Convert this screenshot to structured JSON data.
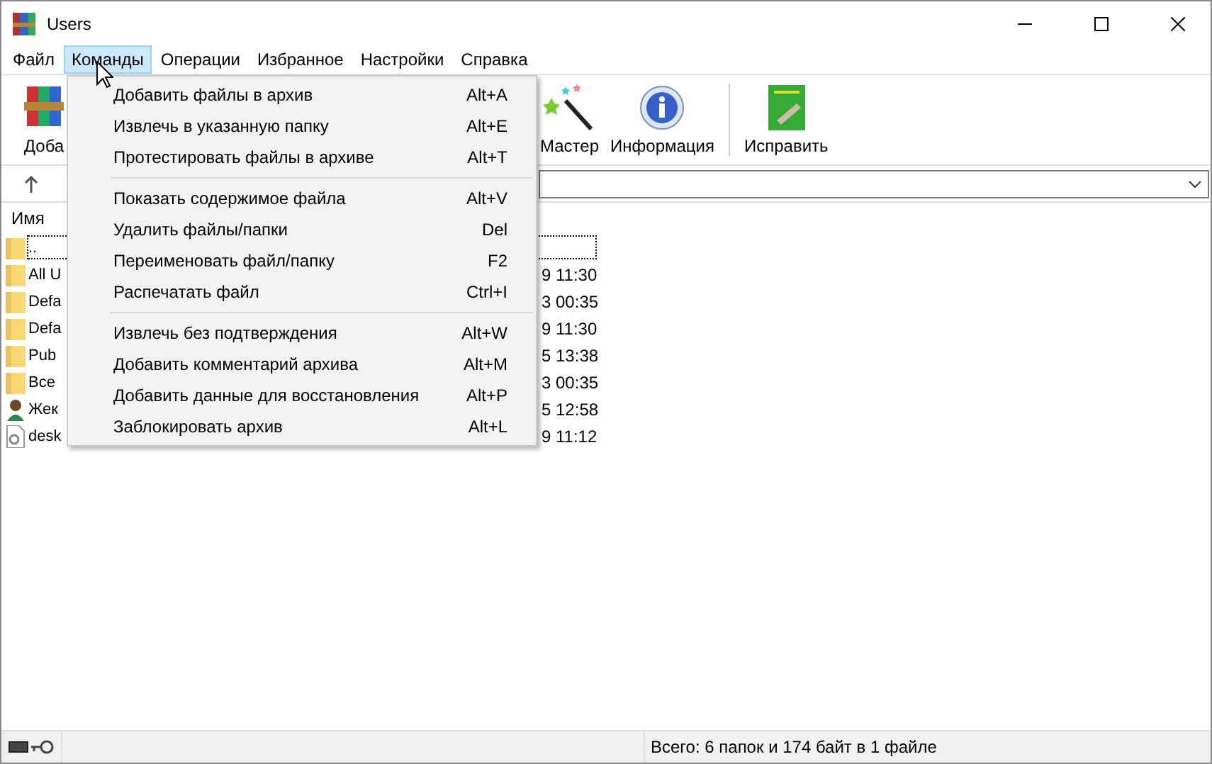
{
  "window": {
    "title": "Users"
  },
  "menubar": [
    {
      "label": "Файл",
      "selected": false
    },
    {
      "label": "Команды",
      "selected": true
    },
    {
      "label": "Операции",
      "selected": false
    },
    {
      "label": "Избранное",
      "selected": false
    },
    {
      "label": "Настройки",
      "selected": false
    },
    {
      "label": "Справка",
      "selected": false
    }
  ],
  "toolbar": [
    {
      "label": "Доба",
      "kind": "archive",
      "separator_before": false
    },
    {
      "label": "Мастер",
      "kind": "wizard",
      "separator_before": false
    },
    {
      "label": "Информация",
      "kind": "info",
      "separator_before": false
    },
    {
      "label": "Исправить",
      "kind": "repair",
      "separator_before": true
    }
  ],
  "file_list": {
    "columns": [
      "Имя"
    ],
    "rows": [
      {
        "name": "..",
        "kind": "folder",
        "focused": true
      },
      {
        "name": "All U",
        "kind": "folder",
        "focused": false,
        "modified": "9 11:30"
      },
      {
        "name": "Defa",
        "kind": "folder",
        "focused": false,
        "modified": "3 00:35"
      },
      {
        "name": "Defa",
        "kind": "folder",
        "focused": false,
        "modified": "9 11:30"
      },
      {
        "name": "Pub",
        "kind": "folder",
        "focused": false,
        "modified": "5 13:38"
      },
      {
        "name": "Все",
        "kind": "folder",
        "focused": false,
        "modified": "3 00:35"
      },
      {
        "name": "Жек",
        "kind": "user",
        "focused": false,
        "modified": "5 12:58"
      },
      {
        "name": "desk",
        "kind": "file",
        "focused": false,
        "modified": "9 11:12"
      }
    ]
  },
  "commands_menu": {
    "groups": [
      [
        {
          "label": "Добавить файлы в архив",
          "shortcut": "Alt+A"
        },
        {
          "label": "Извлечь в указанную папку",
          "shortcut": "Alt+E"
        },
        {
          "label": "Протестировать файлы в архиве",
          "shortcut": "Alt+T"
        }
      ],
      [
        {
          "label": "Показать содержимое файла",
          "shortcut": "Alt+V"
        },
        {
          "label": "Удалить файлы/папки",
          "shortcut": "Del"
        },
        {
          "label": "Переименовать файл/папку",
          "shortcut": "F2"
        },
        {
          "label": "Распечатать файл",
          "shortcut": "Ctrl+I"
        }
      ],
      [
        {
          "label": "Извлечь без подтверждения",
          "shortcut": "Alt+W"
        },
        {
          "label": "Добавить комментарий архива",
          "shortcut": "Alt+M"
        },
        {
          "label": "Добавить данные для восстановления",
          "shortcut": "Alt+P"
        },
        {
          "label": "Заблокировать архив",
          "shortcut": "Alt+L"
        }
      ]
    ]
  },
  "status_bar": {
    "text": "Всего: 6 папок и 174 байт в 1 файле"
  }
}
